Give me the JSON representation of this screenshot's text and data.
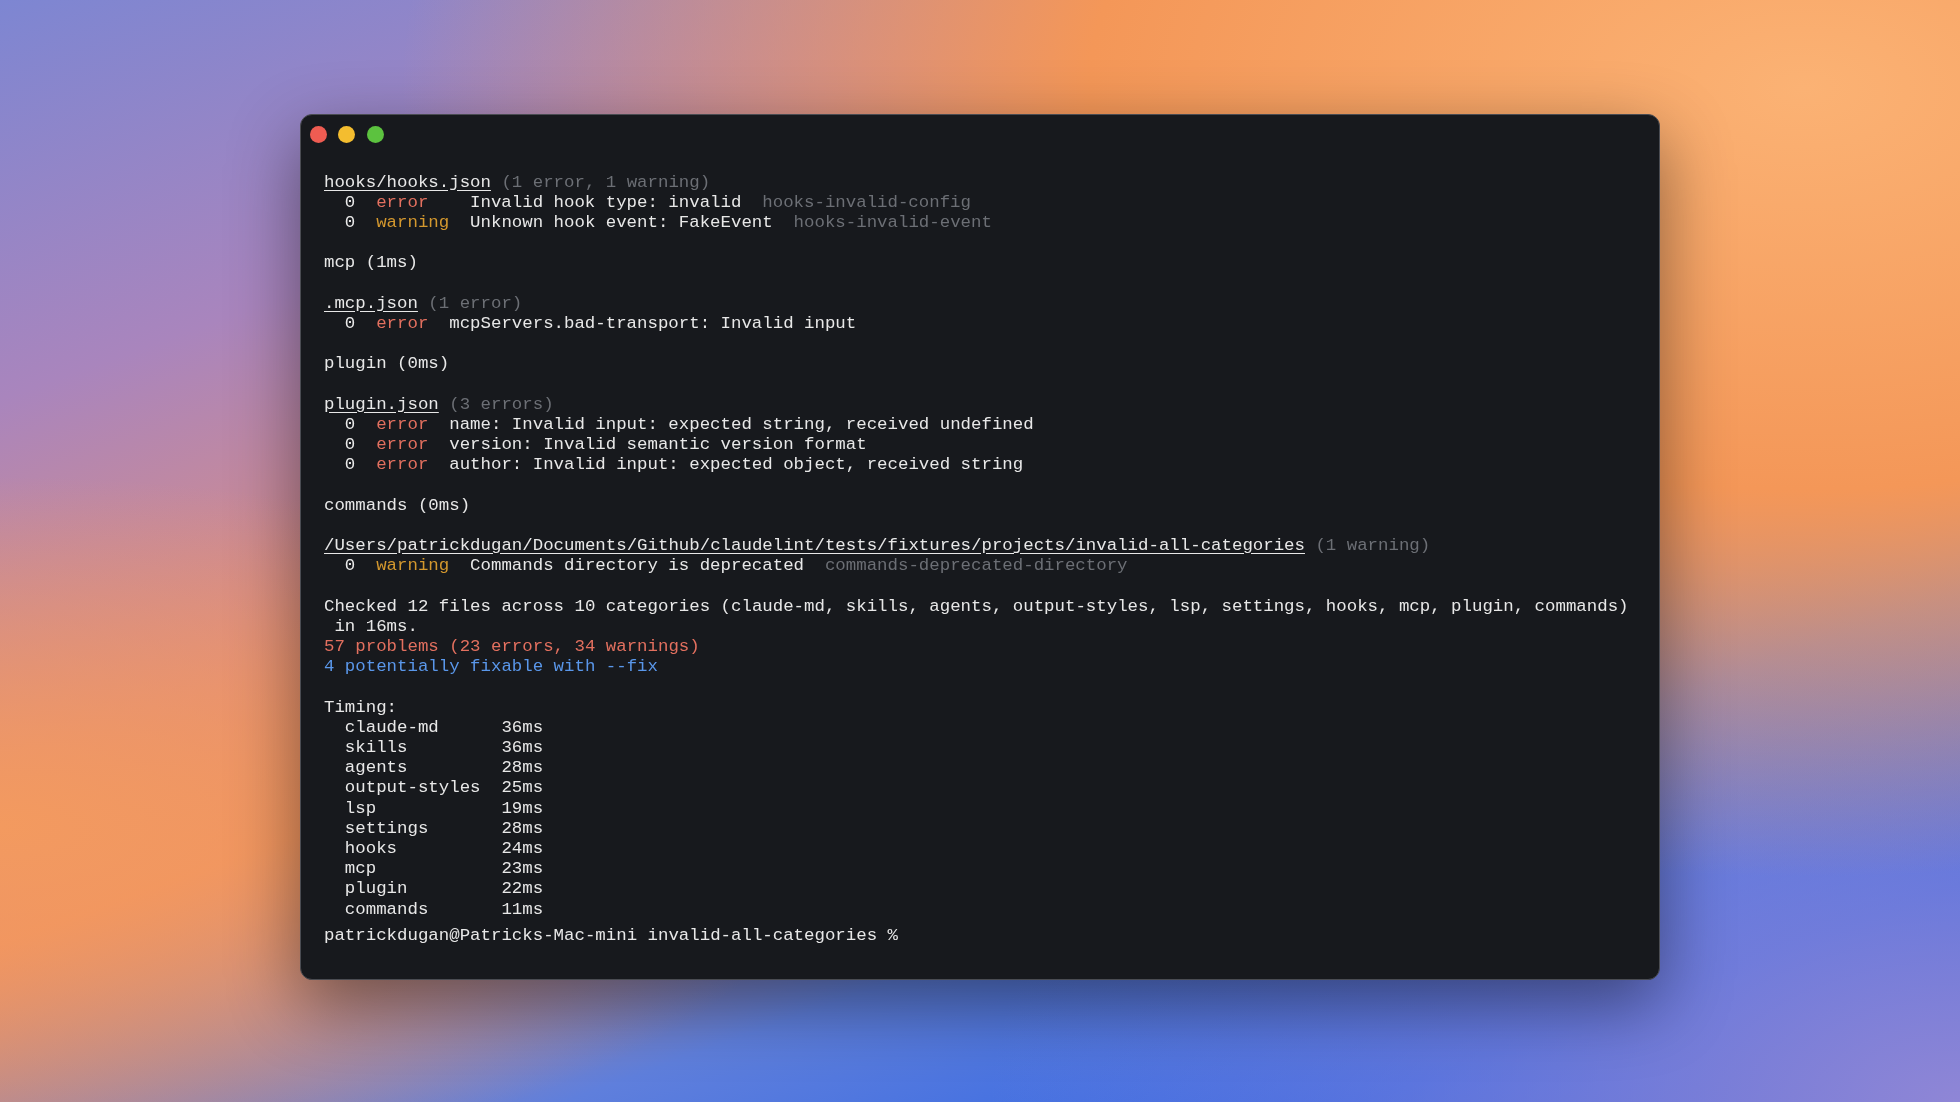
{
  "window": {
    "controls": [
      {
        "color": "#ee5c52"
      },
      {
        "color": "#f4bd2f"
      },
      {
        "color": "#5cc23f"
      }
    ]
  },
  "output": {
    "blocks": [
      {
        "lines": [
          {
            "kind": "file",
            "path": "hooks/hooks.json",
            "counts": "(1 error, 1 warning)"
          },
          {
            "kind": "issue",
            "line": "0",
            "severity": "error",
            "color": "#e3705f",
            "message": "Invalid hook type: invalid",
            "rule": "hooks-invalid-config"
          },
          {
            "kind": "issue",
            "line": "0",
            "severity": "warning",
            "color": "#d4982e",
            "message": "Unknown hook event: FakeEvent",
            "rule": "hooks-invalid-event"
          }
        ]
      },
      {
        "lines": [
          {
            "kind": "heading",
            "text": "mcp (1ms)"
          }
        ]
      },
      {
        "lines": [
          {
            "kind": "file",
            "path": ".mcp.json",
            "counts": "(1 error)"
          },
          {
            "kind": "issue",
            "line": "0",
            "severity": "error",
            "color": "#e3705f",
            "message": "mcpServers.bad-transport: Invalid input"
          }
        ]
      },
      {
        "lines": [
          {
            "kind": "heading",
            "text": "plugin (0ms)"
          }
        ]
      },
      {
        "lines": [
          {
            "kind": "file",
            "path": "plugin.json",
            "counts": "(3 errors)"
          },
          {
            "kind": "issue",
            "line": "0",
            "severity": "error",
            "color": "#e3705f",
            "message": "name: Invalid input: expected string, received undefined"
          },
          {
            "kind": "issue",
            "line": "0",
            "severity": "error",
            "color": "#e3705f",
            "message": "version: Invalid semantic version format"
          },
          {
            "kind": "issue",
            "line": "0",
            "severity": "error",
            "color": "#e3705f",
            "message": "author: Invalid input: expected object, received string"
          }
        ]
      },
      {
        "lines": [
          {
            "kind": "heading",
            "text": "commands (0ms)"
          }
        ]
      },
      {
        "lines": [
          {
            "kind": "file",
            "path": "/Users/patrickdugan/Documents/Github/claudelint/tests/fixtures/projects/invalid-all-categories",
            "counts": "(1 warning)"
          },
          {
            "kind": "issue",
            "line": "0",
            "severity": "warning",
            "color": "#d4982e",
            "message": "Commands directory is deprecated",
            "rule": "commands-deprecated-directory"
          }
        ]
      },
      {
        "lines": [
          {
            "kind": "summary",
            "text": "Checked 12 files across 10 categories (claude-md, skills, agents, output-styles, lsp, settings, hooks, mcp, plugin, commands) in 16ms."
          },
          {
            "kind": "problems",
            "text": "57 problems (23 errors, 34 warnings)"
          },
          {
            "kind": "hint",
            "text": "4 potentially fixable with --fix"
          }
        ]
      },
      {
        "lines": [
          {
            "kind": "heading",
            "text": "Timing:"
          },
          {
            "kind": "timing",
            "name": "claude-md",
            "duration": "36ms"
          },
          {
            "kind": "timing",
            "name": "skills",
            "duration": "36ms"
          },
          {
            "kind": "timing",
            "name": "agents",
            "duration": "28ms"
          },
          {
            "kind": "timing",
            "name": "output-styles",
            "duration": "25ms"
          },
          {
            "kind": "timing",
            "name": "lsp",
            "duration": "19ms"
          },
          {
            "kind": "timing",
            "name": "settings",
            "duration": "28ms"
          },
          {
            "kind": "timing",
            "name": "hooks",
            "duration": "24ms"
          },
          {
            "kind": "timing",
            "name": "mcp",
            "duration": "23ms"
          },
          {
            "kind": "timing",
            "name": "plugin",
            "duration": "22ms"
          },
          {
            "kind": "timing",
            "name": "commands",
            "duration": "11ms"
          }
        ]
      }
    ]
  },
  "prompt": "patrickdugan@Patricks-Mac-mini invalid-all-categories %"
}
